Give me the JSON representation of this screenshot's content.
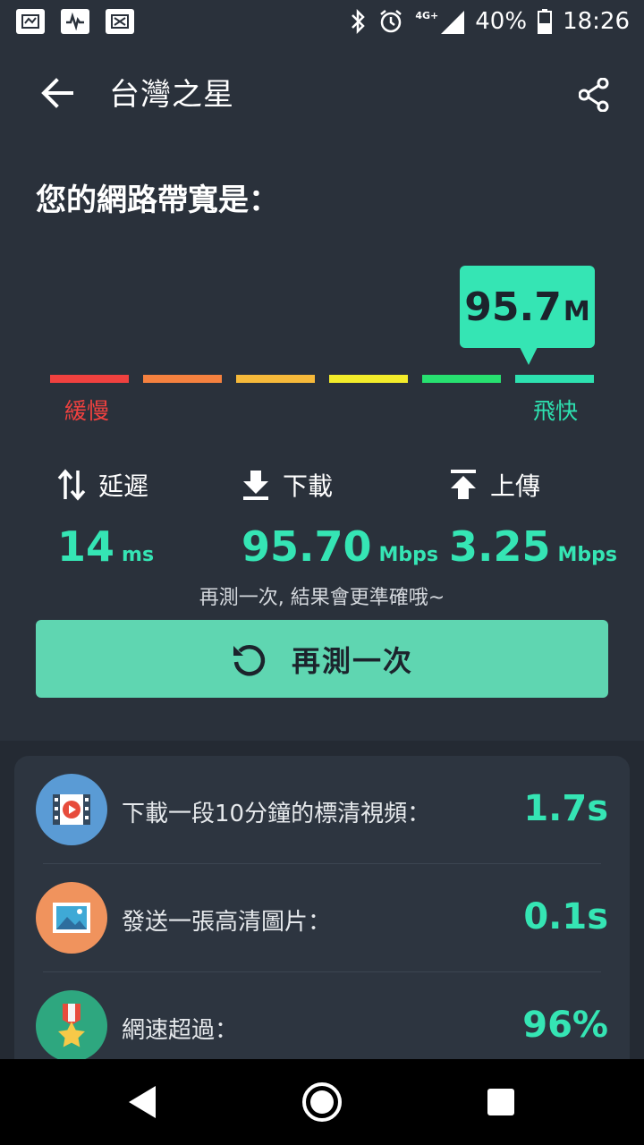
{
  "status_bar": {
    "network": "4G+",
    "battery": "40%",
    "time": "18:26"
  },
  "app_bar": {
    "title": "台灣之星",
    "back_icon": "arrow-left-icon",
    "share_icon": "share-icon"
  },
  "heading": "您的網路帶寬是：",
  "gauge": {
    "value": "95.7",
    "unit": "M",
    "slow_label": "緩慢",
    "fast_label": "飛快",
    "segment_colors": [
      "#f0413f",
      "#f5813f",
      "#f6b93a",
      "#f3ec2a",
      "#27e070",
      "#2de1b0"
    ],
    "slow_color": "#f0413f",
    "fast_color": "#2de1b0"
  },
  "metrics": {
    "latency": {
      "label": "延遲",
      "value": "14",
      "unit": "ms",
      "icon": "latency-arrows-icon"
    },
    "download": {
      "label": "下載",
      "value": "95.70",
      "unit": "Mbps",
      "icon": "download-icon"
    },
    "upload": {
      "label": "上傳",
      "value": "3.25",
      "unit": "Mbps",
      "icon": "upload-icon"
    }
  },
  "hint": "再測一次, 結果會更準確哦~",
  "retest_button": {
    "label": "再測一次",
    "icon": "refresh-icon"
  },
  "results": [
    {
      "label": "下載一段10分鐘的標清視頻：",
      "value": "1.7s",
      "icon": "video-icon",
      "color": "#5a9bd5"
    },
    {
      "label": "發送一張高清圖片：",
      "value": "0.1s",
      "icon": "image-icon",
      "color": "#f0935d"
    },
    {
      "label": "網速超過：",
      "value": "96%",
      "icon": "medal-icon",
      "color": "#2ea77f"
    }
  ],
  "accent_color": "#35e5b4"
}
